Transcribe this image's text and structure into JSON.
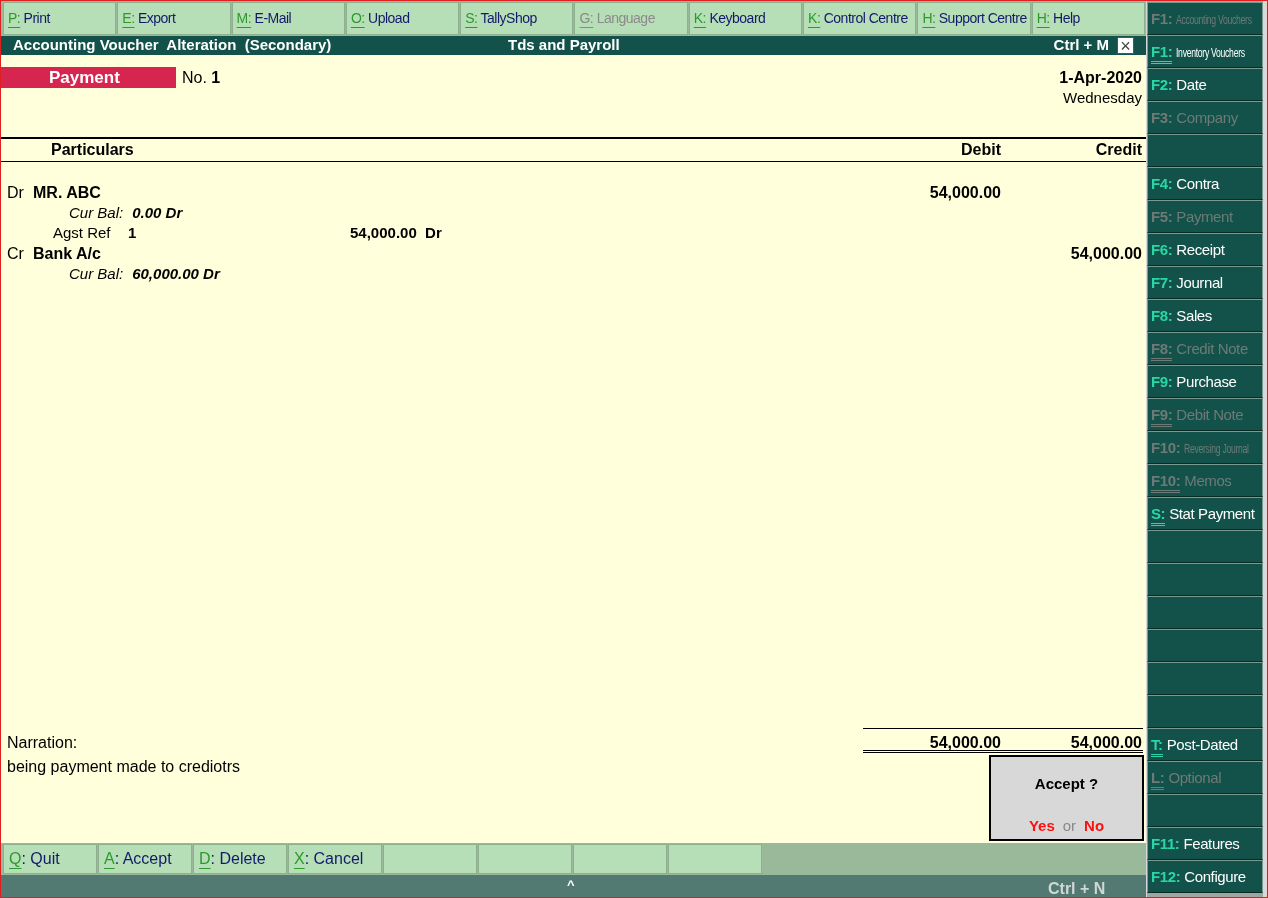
{
  "top_buttons": [
    {
      "key": "P:",
      "label": "Print",
      "disabled": false
    },
    {
      "key": "E:",
      "label": "Export",
      "disabled": false
    },
    {
      "key": "M:",
      "label": "E-Mail",
      "disabled": false
    },
    {
      "key": "O:",
      "label": "Upload",
      "disabled": false
    },
    {
      "key": "S:",
      "label": "TallyShop",
      "disabled": false
    },
    {
      "key": "G:",
      "label": "Language",
      "disabled": true
    },
    {
      "key": "K:",
      "label": "Keyboard",
      "disabled": false
    },
    {
      "key": "K:",
      "label": "Control Centre",
      "disabled": false
    },
    {
      "key": "H:",
      "label": "Support Centre",
      "disabled": false
    },
    {
      "key": "H:",
      "label": "Help",
      "disabled": false
    }
  ],
  "title_bar": {
    "title": "Accounting Voucher  Alteration  (Secondary)",
    "company": "Tds and Payroll",
    "shortcut": "Ctrl + M",
    "close": "×"
  },
  "voucher": {
    "type": "Payment",
    "number_label": "No.",
    "number": "1",
    "date": "1-Apr-2020",
    "day": "Wednesday"
  },
  "columns": {
    "particulars": "Particulars",
    "debit": "Debit",
    "credit": "Credit"
  },
  "entries": [
    {
      "side": "Dr",
      "ledger": "MR. ABC",
      "debit": "54,000.00",
      "balance_label": "Cur Bal:",
      "balance": "0.00 Dr",
      "refs": [
        {
          "type": "Agst Ref",
          "name": "1",
          "amount": "54,000.00",
          "side": "Dr"
        }
      ]
    },
    {
      "side": "Cr",
      "ledger": "Bank A/c",
      "credit": "54,000.00",
      "balance_label": "Cur Bal:",
      "balance": "60,000.00 Dr"
    }
  ],
  "narration": {
    "label": "Narration:",
    "text": "being payment made to crediotrs"
  },
  "totals": {
    "debit": "54,000.00",
    "credit": "54,000.00"
  },
  "dialog": {
    "question": "Accept ?",
    "yes": "Yes",
    "or": "or",
    "no": "No"
  },
  "bottom_buttons": [
    {
      "kind": "button",
      "key": "Q",
      "label": ": Quit"
    },
    {
      "kind": "button",
      "key": "A",
      "label": ": Accept"
    },
    {
      "kind": "button",
      "key": "D",
      "label": ": Delete"
    },
    {
      "kind": "button",
      "key": "X",
      "label": ": Cancel"
    },
    {
      "kind": "blank"
    },
    {
      "kind": "blank"
    },
    {
      "kind": "blank"
    },
    {
      "kind": "blank"
    }
  ],
  "status_bar": {
    "caret": "^",
    "shortcut": "Ctrl + N"
  },
  "sidebar": [
    {
      "kind": "button",
      "key": "F1:",
      "label": "Accounting Vouchers",
      "disabled": true,
      "condensed": true,
      "underlined": false
    },
    {
      "kind": "button",
      "key": "F1:",
      "label": "Inventory Vouchers",
      "disabled": false,
      "condensed": true,
      "underlined": true
    },
    {
      "kind": "button",
      "key": "F2:",
      "label": "Date",
      "disabled": false,
      "condensed": false,
      "underlined": false
    },
    {
      "kind": "button",
      "key": "F3:",
      "label": "Company",
      "disabled": true,
      "condensed": false,
      "underlined": false
    },
    {
      "kind": "blank"
    },
    {
      "kind": "button",
      "key": "F4:",
      "label": "Contra",
      "disabled": false,
      "condensed": false,
      "underlined": false
    },
    {
      "kind": "button",
      "key": "F5:",
      "label": "Payment",
      "disabled": true,
      "condensed": false,
      "underlined": false
    },
    {
      "kind": "button",
      "key": "F6:",
      "label": "Receipt",
      "disabled": false,
      "condensed": false,
      "underlined": false
    },
    {
      "kind": "button",
      "key": "F7:",
      "label": "Journal",
      "disabled": false,
      "condensed": false,
      "underlined": false
    },
    {
      "kind": "button",
      "key": "F8:",
      "label": "Sales",
      "disabled": false,
      "condensed": false,
      "underlined": false
    },
    {
      "kind": "button",
      "key": "F8:",
      "label": "Credit Note",
      "disabled": true,
      "condensed": false,
      "underlined": true
    },
    {
      "kind": "button",
      "key": "F9:",
      "label": "Purchase",
      "disabled": false,
      "condensed": false,
      "underlined": false
    },
    {
      "kind": "button",
      "key": "F9:",
      "label": "Debit Note",
      "disabled": true,
      "condensed": false,
      "underlined": true
    },
    {
      "kind": "button",
      "key": "F10:",
      "label": "Reversing Journal",
      "disabled": true,
      "condensed": true,
      "underlined": false
    },
    {
      "kind": "button",
      "key": "F10:",
      "label": "Memos",
      "disabled": true,
      "condensed": false,
      "underlined": true
    },
    {
      "kind": "button",
      "key": "S:",
      "label": "Stat Payment",
      "disabled": false,
      "condensed": false,
      "underlined": true
    },
    {
      "kind": "blank"
    },
    {
      "kind": "blank"
    },
    {
      "kind": "blank"
    },
    {
      "kind": "blank"
    },
    {
      "kind": "blank"
    },
    {
      "kind": "blank"
    },
    {
      "kind": "button",
      "key": "T:",
      "label": "Post-Dated",
      "disabled": false,
      "condensed": false,
      "underlined": true
    },
    {
      "kind": "button",
      "key": "L:",
      "label": "Optional",
      "disabled": true,
      "condensed": false,
      "underlined": true
    },
    {
      "kind": "blank"
    },
    {
      "kind": "button",
      "key": "F11:",
      "label": "Features",
      "disabled": false,
      "condensed": false,
      "underlined": false
    },
    {
      "kind": "button",
      "key": "F12:",
      "label": "Configure",
      "disabled": false,
      "condensed": false,
      "underlined": false
    }
  ]
}
